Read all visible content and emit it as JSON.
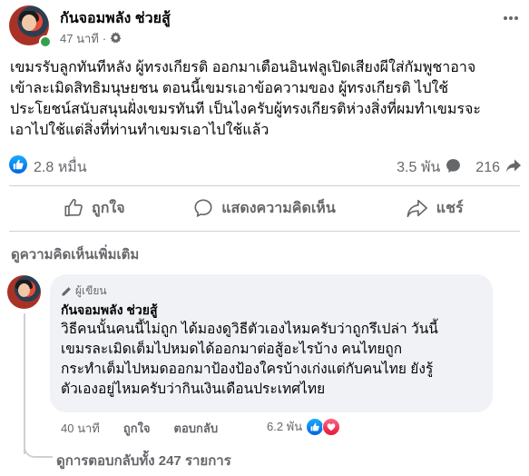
{
  "post": {
    "page_name": "กันจอมพลัง ช่วยสู้",
    "time": "47 นาที",
    "separator": "·",
    "audience_icon": "settings-gear-icon",
    "more_icon": "more-horizontal-icon",
    "text": "เขมรรับลูกทันทีหลัง ผู้ทรงเกียรติ ออกมาเตือนอินฟลูเปิดเสียงผีใส่กัมพูชาอาจ\nเข้าละเมิดสิทธิมนุษยชน ตอนนี้เขมรเอาข้อความของ ผู้ทรงเกียรติ ไปใช้\nประโยชน์สนับสนุนฝั่งเขมรทันที เป็นไงครับผู้ทรงเกียรติห่วงสิ่งที่ผมทำเขมรจะ\nเอาไปใช้แต่สิ่งที่ท่านทำเขมรเอาไปใช้แล้ว"
  },
  "stats": {
    "reactions": "2.8 หมื่น",
    "comments": "3.5 พัน",
    "shares": "216"
  },
  "actions": {
    "like": "ถูกใจ",
    "comment": "แสดงความคิดเห็น",
    "share": "แชร์"
  },
  "more_comments": "ดูความคิดเห็นเพิ่มเติม",
  "comment": {
    "badge": "ผู้เขียน",
    "name": "กันจอมพลัง ช่วยสู้",
    "text": "วิธีคนนั้นคนนี้ไม่ถูก ได้มองดูวิธีตัวเองไหมครับว่าถูกรึเปล่า วันนี้\nเขมรละเมิดเต็มไปหมดได้ออกมาต่อสู้อะไรบ้าง คนไทยถูก\nกระทำเต็มไปหมดออกมาป้องป้องใครบ้างเก่งแต่กับคนไทย ยังรู้\nตัวเองอยู่ไหมครับว่ากินเงินเดือนประเทศไทย",
    "time": "40 นาที",
    "like": "ถูกใจ",
    "reply": "ตอบกลับ",
    "reaction_count": "6.2 พัน"
  },
  "replies_link": "ดูการตอบกลับทั้ง 247 รายการ",
  "colors": {
    "like_blue": "#0866ff",
    "love_red": "#f33e58",
    "online_green": "#31a24c",
    "secondary_text": "#65676b"
  }
}
